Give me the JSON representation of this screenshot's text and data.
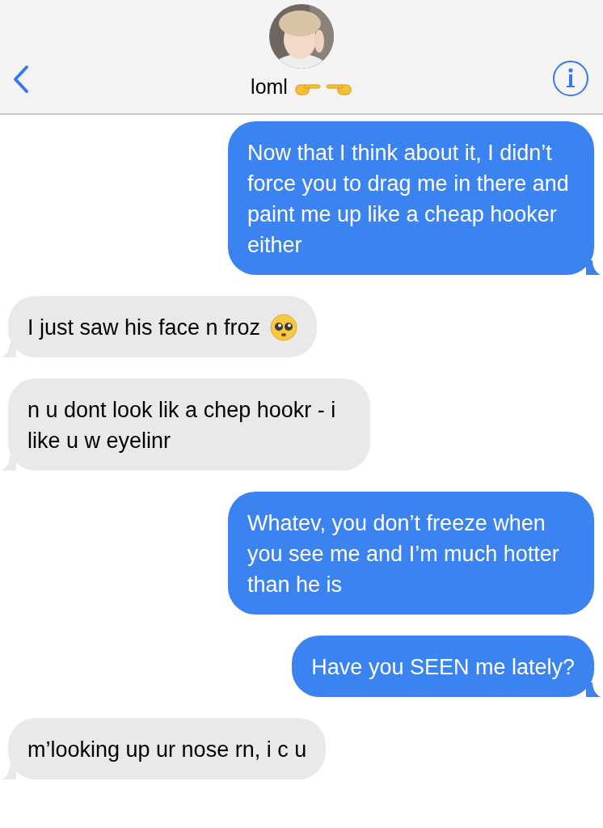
{
  "header": {
    "contact_name": "loml",
    "name_emoji": {
      "kind": "pointing-hands"
    }
  },
  "messages": [
    {
      "kind": "sent",
      "text": "Now that I think about it, I didn’t force you to drag me in there and paint me up like a cheap hooker either",
      "tail": true
    },
    {
      "kind": "received",
      "text": "I just saw his face n froz",
      "emoji": {
        "kind": "pleading"
      },
      "tail": true
    },
    {
      "kind": "received",
      "text": "n u dont look lik a chep hookr - i like u w eyelinr",
      "tail": true
    },
    {
      "kind": "sent",
      "text": "Whatev, you don’t freeze when you see me and I’m much hotter than he is",
      "tail": false
    },
    {
      "kind": "sent",
      "text": "Have you SEEN me lately?",
      "tail": true
    },
    {
      "kind": "received",
      "text": "m’looking up ur nose rn, i c u",
      "tail": true
    }
  ]
}
